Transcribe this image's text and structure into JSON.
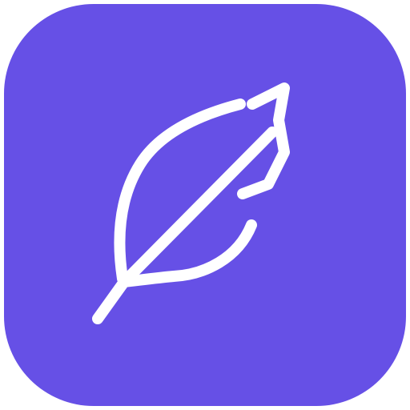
{
  "icon": {
    "name": "feather-app-icon",
    "glyph": "feather-icon",
    "colors": {
      "background": "#6650E6",
      "stroke": "#FFFFFF"
    }
  }
}
